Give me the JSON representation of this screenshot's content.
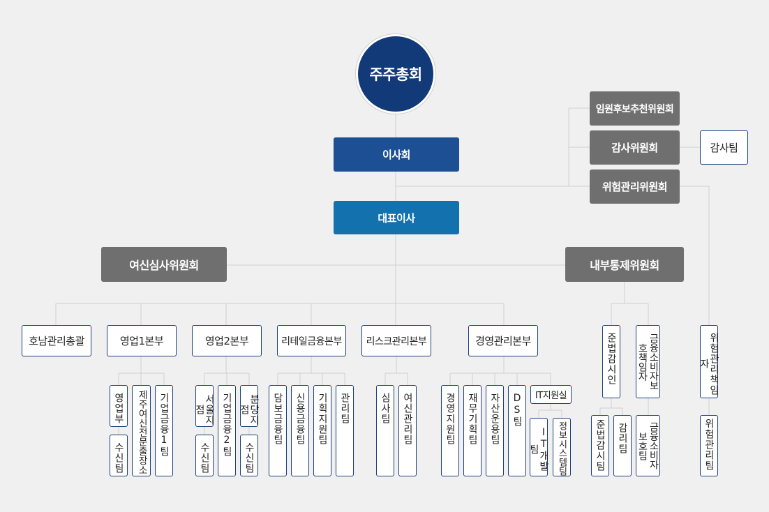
{
  "top": {
    "shareholders": "주주총회",
    "board": "이사회",
    "ceo": "대표이사"
  },
  "board_committees": {
    "nomination": "임원후보추천위원회",
    "audit": "감사위원회",
    "audit_team": "감사팀",
    "risk": "위험관리위원회"
  },
  "committees": {
    "credit": "여신심사위원회",
    "internal_control": "내부통제위원회"
  },
  "divisions": {
    "honam": "호남관리총괄",
    "sales1": "영업1본부",
    "sales2": "영업2본부",
    "retail": "리테일금융본부",
    "risk": "리스크관리본부",
    "mgmt": "경영관리본부"
  },
  "officers": {
    "compliance": "준법감시인",
    "consumer": "금융소비자보호책임자",
    "risk_officer": "위험관리책임자"
  },
  "teams": {
    "sales_dept": "영업부",
    "deposit_a": "수신팀",
    "jeju": "제주여신전문출장소",
    "corp1": "기업금융1팀",
    "seoul": "서울지점",
    "deposit_b": "수신팀",
    "corp2": "기업금융2팀",
    "bundang": "분당지점",
    "deposit_c": "수신팀",
    "secured": "담보금융팀",
    "credit_fin": "신용금융팀",
    "planning_support": "기획지원팀",
    "admin": "관리팀",
    "review": "심사팀",
    "credit_mgmt": "여신관리팀",
    "mgmt_support": "경영지원팀",
    "finance_planning": "재무기획팀",
    "asset_mgmt": "자산운용팀",
    "ds": "DS팀",
    "it_office": "IT지원실",
    "it_dev": "IT개발팀",
    "info_sys": "정보시스템팀",
    "compliance_team": "준법감시팀",
    "audit_mgmt": "감리팀",
    "consumer_team": "금융소비자보호팀",
    "risk_team": "위험관리팀"
  },
  "colors": {
    "circle": "#123a78",
    "board": "#1c4f94",
    "ceo": "#1372ad",
    "committee": "#6f6f6f",
    "border": "#1c3f7d",
    "line": "#cfcfcf"
  }
}
